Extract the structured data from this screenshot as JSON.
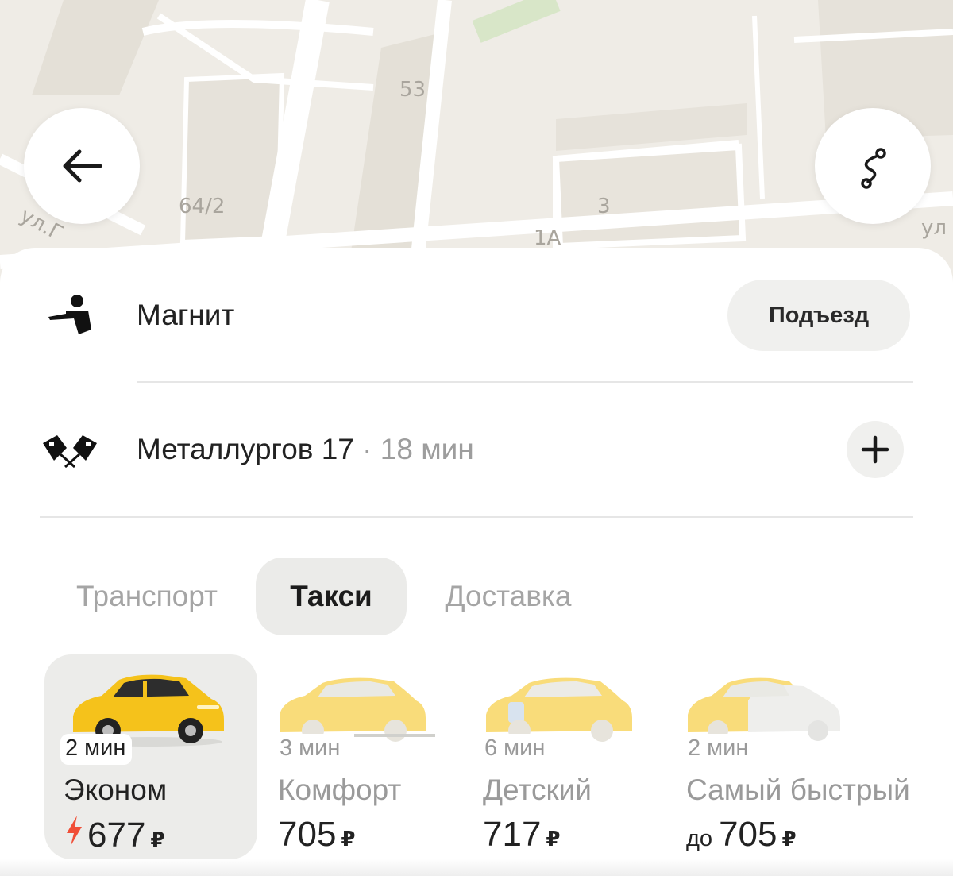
{
  "map": {
    "labels": [
      "53",
      "64/2",
      "3",
      "1А",
      "ул.Г",
      "ул"
    ]
  },
  "buttons": {
    "back_icon": "arrow-left-icon",
    "route_icon": "route-icon"
  },
  "route": {
    "origin": {
      "icon": "person-pin-icon",
      "label": "Магнит",
      "action": "Подъезд"
    },
    "destination": {
      "icon": "checkered-flags-icon",
      "label": "Металлургов 17",
      "separator": "·",
      "duration": "18 мин"
    }
  },
  "tabs": [
    {
      "label": "Транспорт",
      "active": false
    },
    {
      "label": "Такси",
      "active": true
    },
    {
      "label": "Доставка",
      "active": false
    }
  ],
  "tariffs": [
    {
      "eta": "2 мин",
      "name": "Эконом",
      "price": "677",
      "currency": "₽",
      "prefix": "",
      "surge": true,
      "selected": true
    },
    {
      "eta": "3 мин",
      "name": "Комфорт",
      "price": "705",
      "currency": "₽",
      "prefix": "",
      "surge": false,
      "selected": false
    },
    {
      "eta": "6 мин",
      "name": "Детский",
      "price": "717",
      "currency": "₽",
      "prefix": "",
      "surge": false,
      "selected": false
    },
    {
      "eta": "2 мин",
      "name": "Самый быстрый",
      "price": "705",
      "currency": "₽",
      "prefix": "до",
      "surge": false,
      "selected": false
    }
  ],
  "colors": {
    "taxi_yellow": "#f5c21b",
    "surge_red": "#f04e37",
    "map_background": "#efece6"
  }
}
